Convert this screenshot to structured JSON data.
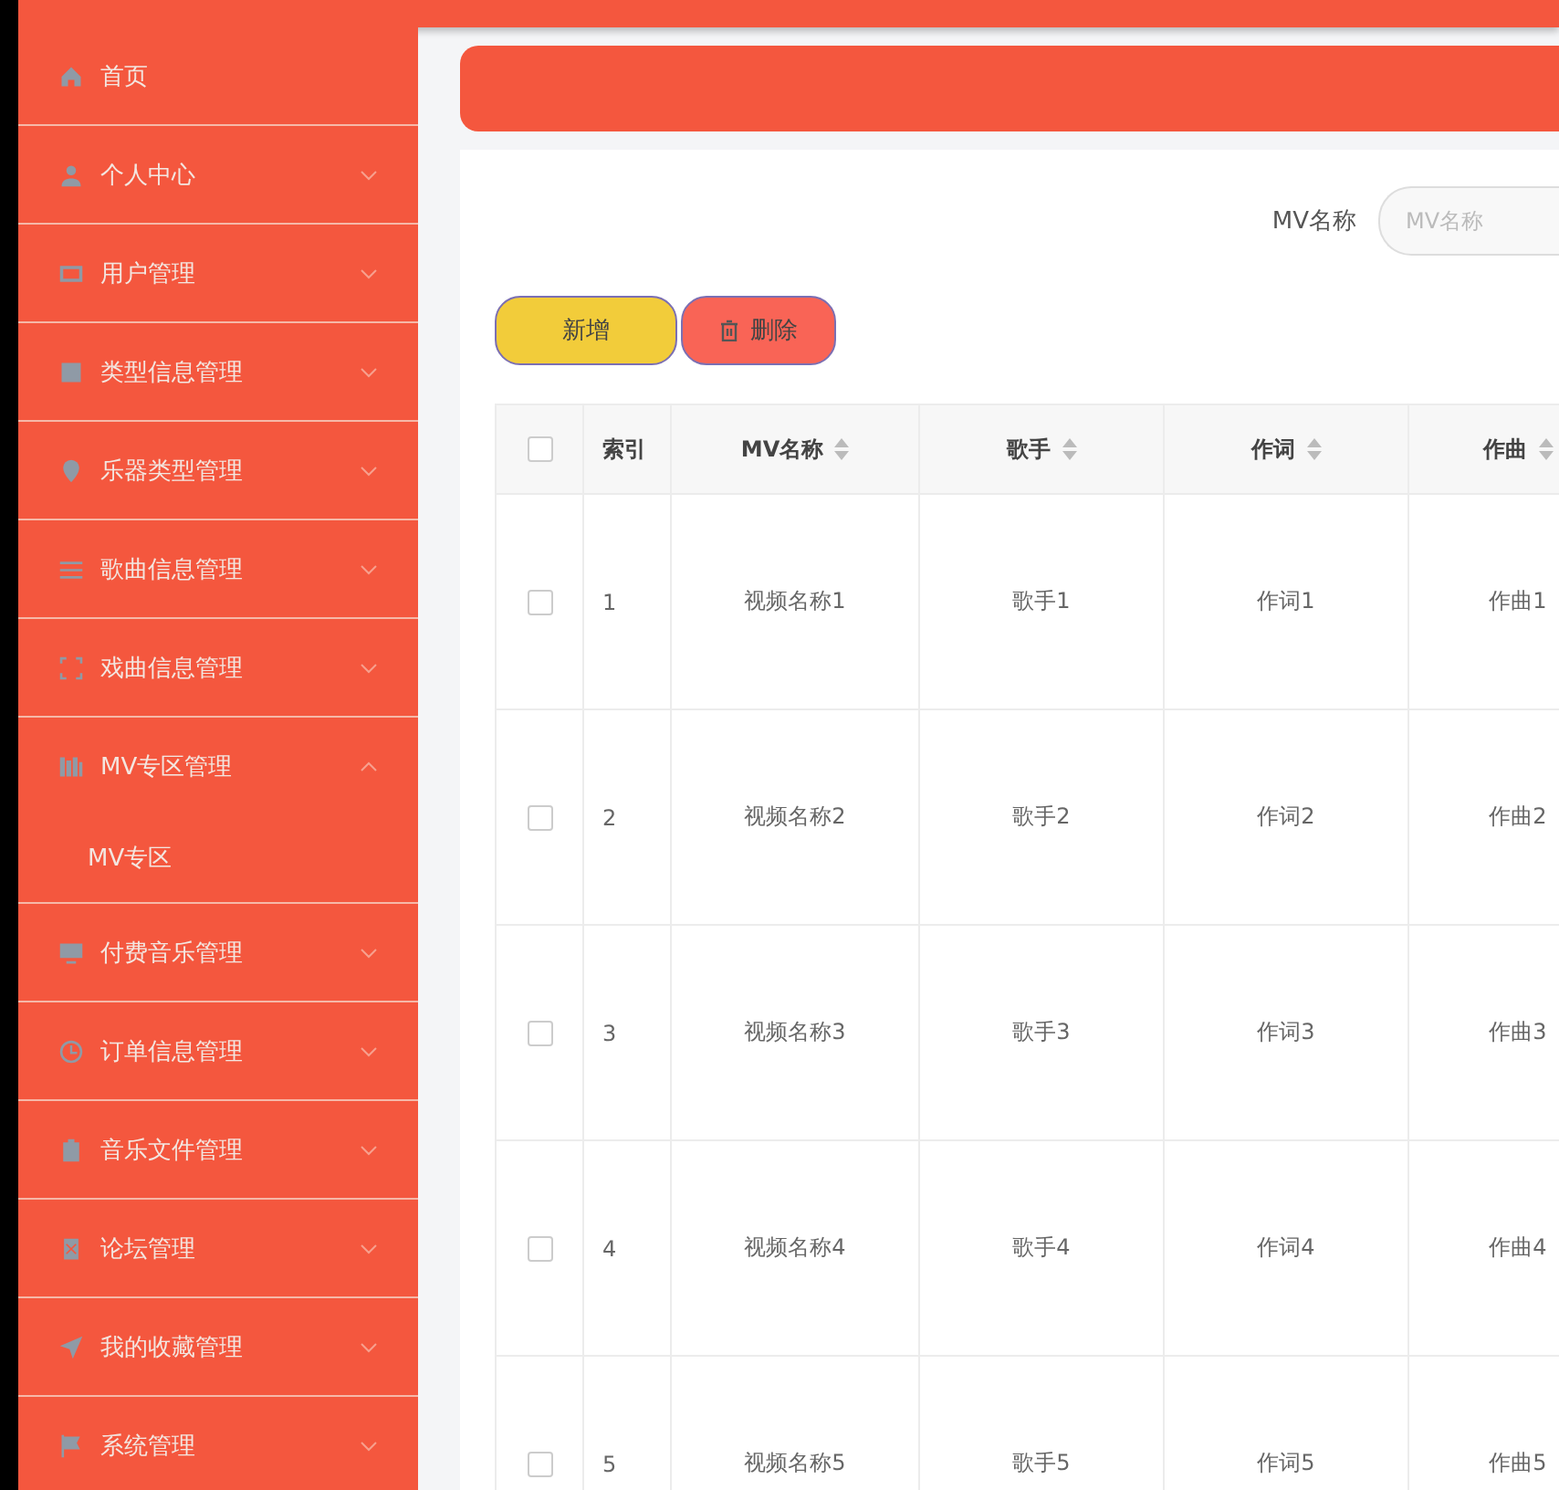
{
  "sidebar": {
    "items": [
      {
        "label": "首页",
        "kind": "link"
      },
      {
        "label": "个人中心",
        "kind": "menu",
        "expanded": false
      },
      {
        "label": "用户管理",
        "kind": "menu",
        "expanded": false
      },
      {
        "label": "类型信息管理",
        "kind": "menu",
        "expanded": false
      },
      {
        "label": "乐器类型管理",
        "kind": "menu",
        "expanded": false
      },
      {
        "label": "歌曲信息管理",
        "kind": "menu",
        "expanded": false
      },
      {
        "label": "戏曲信息管理",
        "kind": "menu",
        "expanded": false
      },
      {
        "label": "MV专区管理",
        "kind": "menu",
        "expanded": true,
        "children": [
          {
            "label": "MV专区"
          }
        ]
      },
      {
        "label": "付费音乐管理",
        "kind": "menu",
        "expanded": false
      },
      {
        "label": "订单信息管理",
        "kind": "menu",
        "expanded": false
      },
      {
        "label": "音乐文件管理",
        "kind": "menu",
        "expanded": false
      },
      {
        "label": "论坛管理",
        "kind": "menu",
        "expanded": false
      },
      {
        "label": "我的收藏管理",
        "kind": "menu",
        "expanded": false
      },
      {
        "label": "系统管理",
        "kind": "menu",
        "expanded": false
      }
    ]
  },
  "search": {
    "label": "MV名称",
    "placeholder": "MV名称"
  },
  "buttons": [
    {
      "label": "新增",
      "kind": "add"
    },
    {
      "label": "删除",
      "kind": "delete"
    }
  ],
  "table": {
    "select_all_checked": false,
    "columns": [
      {
        "label": "索引",
        "sortable": false
      },
      {
        "label": "MV名称",
        "sortable": true
      },
      {
        "label": "歌手",
        "sortable": true
      },
      {
        "label": "作词",
        "sortable": true
      },
      {
        "label": "作曲",
        "sortable": true
      }
    ],
    "rows": [
      {
        "checked": false,
        "cells": [
          "1",
          "视频名称1",
          "歌手1",
          "作词1",
          "作曲1"
        ]
      },
      {
        "checked": false,
        "cells": [
          "2",
          "视频名称2",
          "歌手2",
          "作词2",
          "作曲2"
        ]
      },
      {
        "checked": false,
        "cells": [
          "3",
          "视频名称3",
          "歌手3",
          "作词3",
          "作曲3"
        ]
      },
      {
        "checked": false,
        "cells": [
          "4",
          "视频名称4",
          "歌手4",
          "作词4",
          "作曲4"
        ]
      },
      {
        "checked": false,
        "cells": [
          "5",
          "视频名称5",
          "歌手5",
          "作词5",
          "作曲5"
        ]
      }
    ]
  }
}
